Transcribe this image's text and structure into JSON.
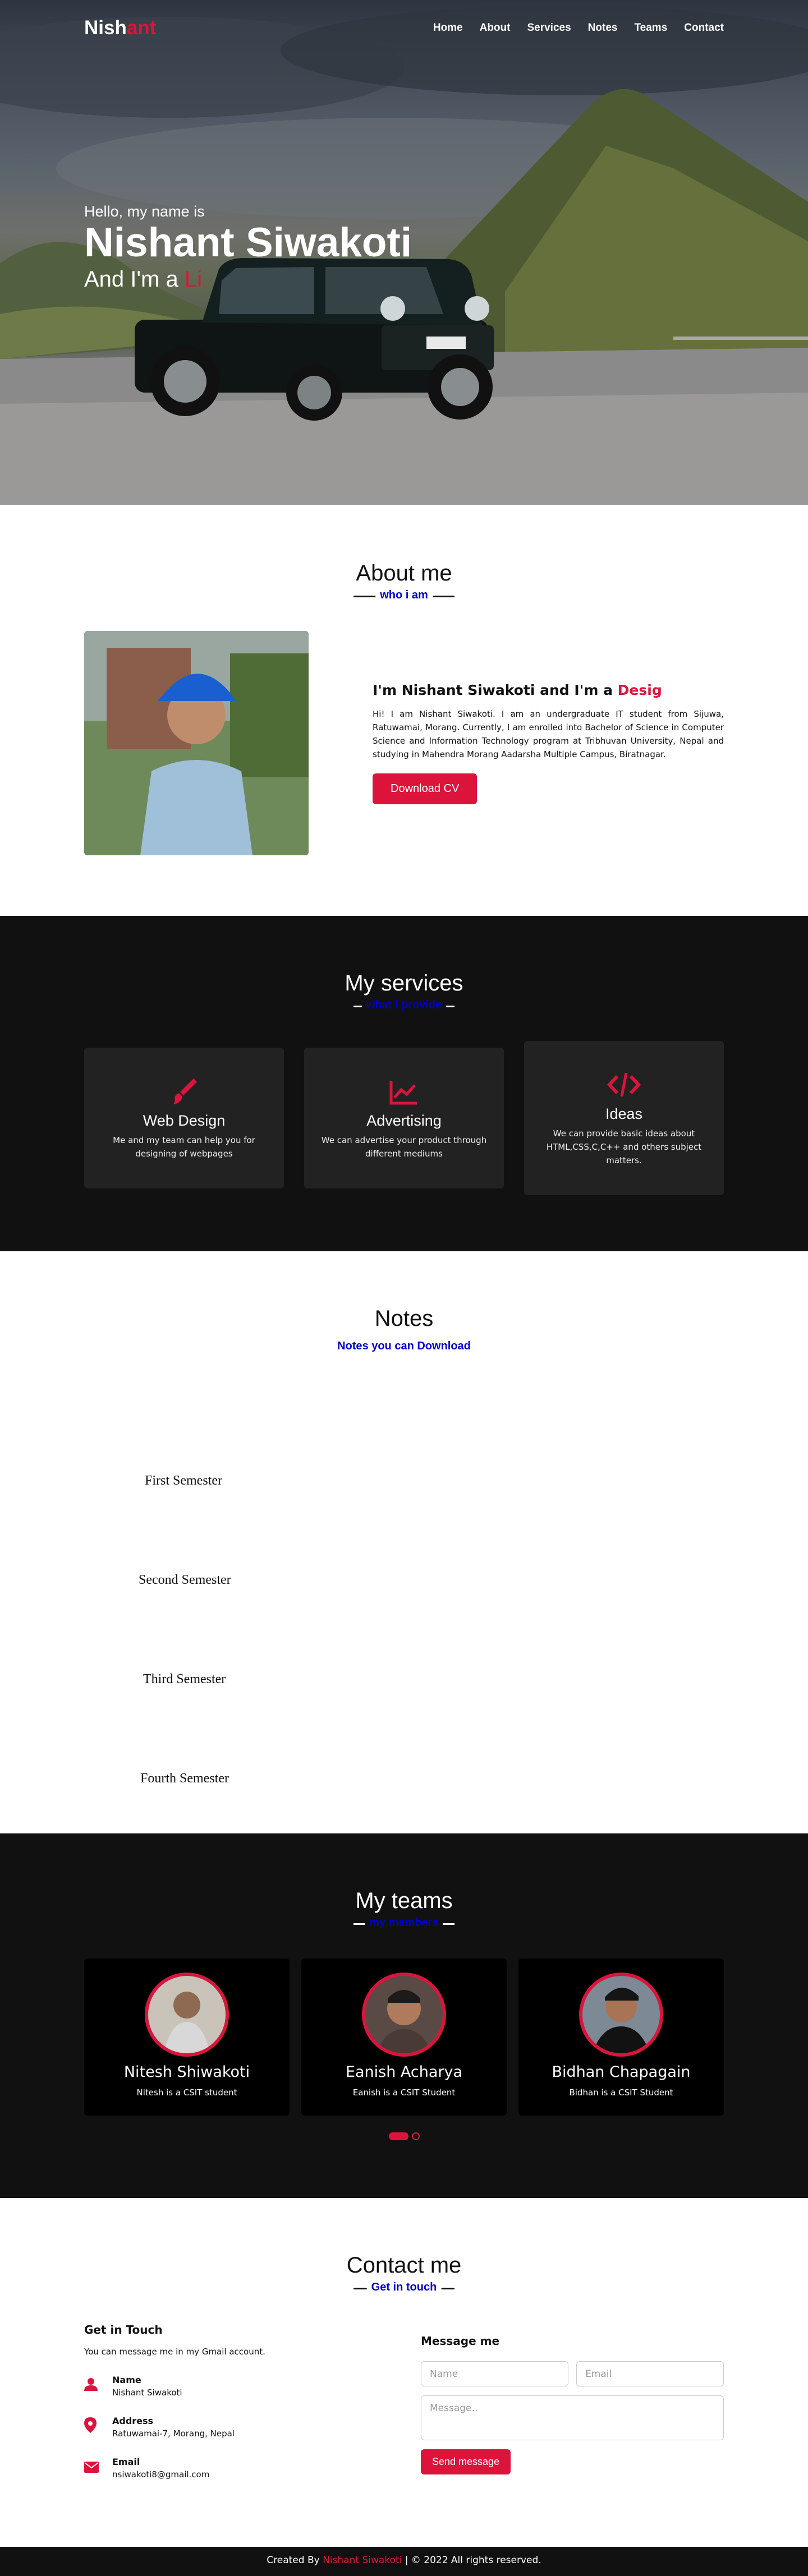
{
  "nav": {
    "logo_main": "Nish",
    "logo_accent": "ant",
    "items": [
      "Home",
      "About",
      "Services",
      "Notes",
      "Teams",
      "Contact"
    ]
  },
  "home": {
    "greeting": "Hello, my name is",
    "name": "Nishant Siwakoti",
    "role_prefix": "And I'm a",
    "role_typing": "Li"
  },
  "about": {
    "title": "About me",
    "subtitle": "who i am",
    "headline_prefix": "I'm Nishant Siwakoti and I'm a",
    "headline_typing": "Desig",
    "paragraph": "Hi! I am Nishant Siwakoti. I am an undergraduate IT student from Sijuwa, Ratuwamai, Morang. Currently, I am enrolled into Bachelor of Science in Computer Science and Information Technology program at Tribhuvan University, Nepal and studying in Mahendra Morang Aadarsha Multiple Campus, Biratnagar.",
    "button": "Download CV"
  },
  "services": {
    "title": "My services",
    "subtitle": "what i provide",
    "cards": [
      {
        "icon": "paintbrush-icon",
        "title": "Web Design",
        "text": "Me and my team can help you for designing of webpages"
      },
      {
        "icon": "chart-line-icon",
        "title": "Advertising",
        "text": "We can advertise your product through different mediums"
      },
      {
        "icon": "code-icon",
        "title": "Ideas",
        "text": "We can provide basic ideas about HTML,CSS,C,C++ and others subject matters."
      }
    ]
  },
  "notes": {
    "title": "Notes",
    "subtitle": "Notes you can Download",
    "semesters": [
      "First Semester",
      "Second Semester",
      "Third Semester",
      "Fourth Semester"
    ]
  },
  "teams": {
    "title": "My teams",
    "subtitle": "my members",
    "members": [
      {
        "name": "Nitesh Shiwakoti",
        "role": "Nitesh is a CSIT student"
      },
      {
        "name": "Eanish Acharya",
        "role": "Eanish is a CSIT Student"
      },
      {
        "name": "Bidhan Chapagain",
        "role": "Bidhan is a CSIT Student"
      }
    ]
  },
  "contact": {
    "title": "Contact me",
    "subtitle": "Get in touch",
    "left_title": "Get in Touch",
    "intro": "You can message me in my Gmail account.",
    "rows": [
      {
        "icon": "user-icon",
        "label": "Name",
        "value": "Nishant Siwakoti"
      },
      {
        "icon": "map-marker-icon",
        "label": "Address",
        "value": "Ratuwamai-7, Morang, Nepal"
      },
      {
        "icon": "envelope-icon",
        "label": "Email",
        "value": "nsiwakoti8@gmail.com"
      }
    ],
    "right_title": "Message me",
    "name_placeholder": "Name",
    "email_placeholder": "Email",
    "message_placeholder": "Message..",
    "send_button": "Send message"
  },
  "footer": {
    "prefix": "Created By",
    "author": "Nishant Siwakoti",
    "suffix": "| © 2022 All rights reserved."
  },
  "colors": {
    "accent": "#dc143c",
    "subtitle": "#0000cd",
    "dark": "#111111",
    "card": "#222222"
  }
}
